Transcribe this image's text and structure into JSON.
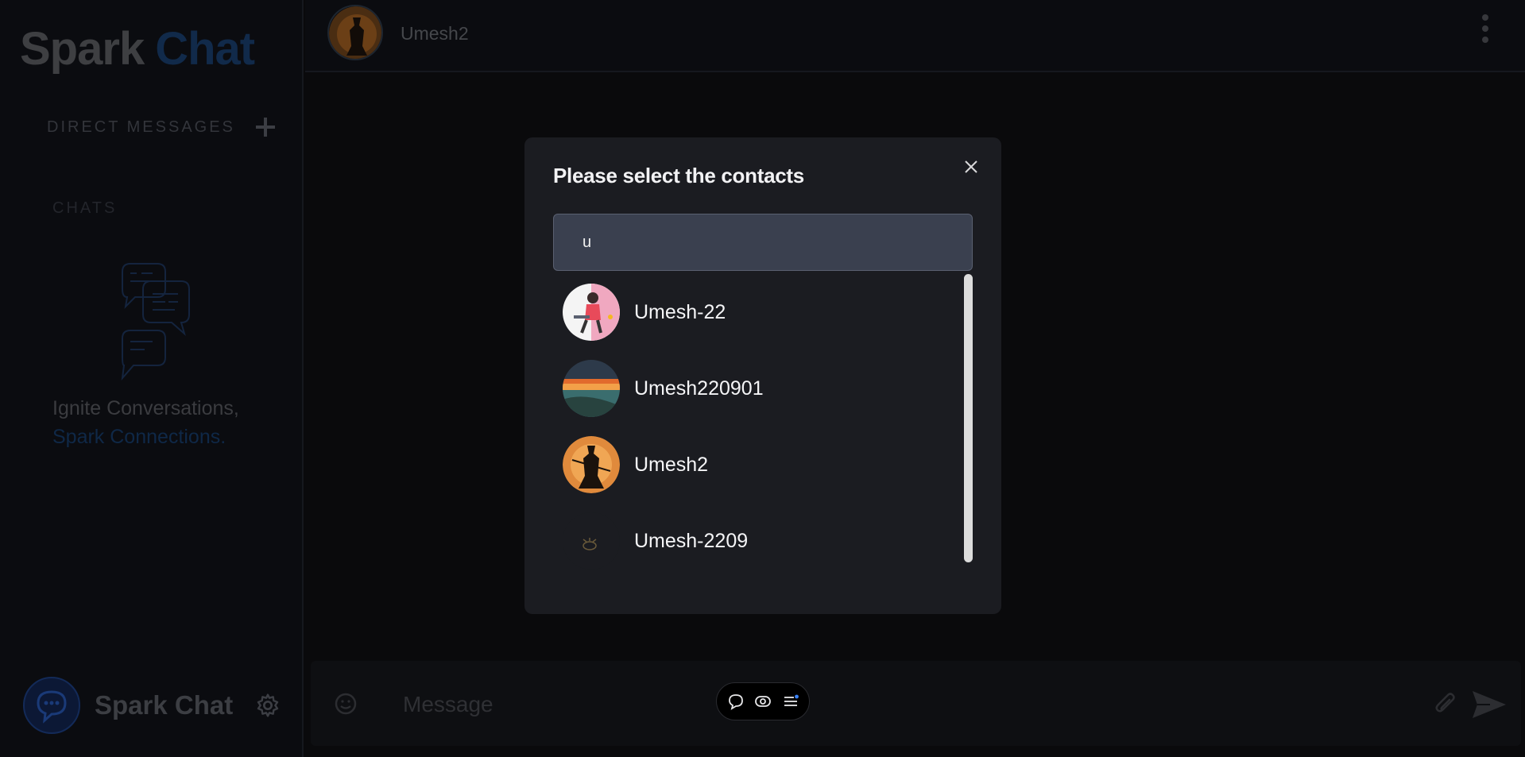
{
  "app": {
    "logo_part1": "Spark",
    "logo_part2": "Chat",
    "colors": {
      "accent": "#112a4a",
      "background": "#0a0a0c",
      "dialog": "#1b1c21",
      "search": "#3a404f"
    }
  },
  "sidebar": {
    "direct_messages_label": "DIRECT MESSAGES",
    "chats_label": "CHATS",
    "tagline_line1": "Ignite Conversations,",
    "tagline_line2": "Spark Connections.",
    "footer_name": "Spark Chat"
  },
  "header": {
    "contact_name": "Umesh2"
  },
  "composer": {
    "placeholder": "Message"
  },
  "dialog": {
    "title": "Please select the contacts",
    "search_value": "u",
    "contacts": [
      {
        "name": "Umesh-22",
        "avatar": "illustration-avatar-icon"
      },
      {
        "name": "Umesh220901",
        "avatar": "sunset-avatar-icon"
      },
      {
        "name": "Umesh2",
        "avatar": "samurai-avatar-icon"
      },
      {
        "name": "Umesh-2209",
        "avatar": "dark-avatar-icon"
      }
    ]
  },
  "icons": {
    "plus": "plus-icon",
    "settings": "gear-icon",
    "menu": "kebab-icon",
    "close": "close-icon",
    "emoji": "emoji-icon",
    "attach": "paperclip-icon",
    "send": "send-icon",
    "toolbar": [
      "chat-bubble-icon",
      "eye-toggle-icon",
      "list-menu-icon"
    ]
  }
}
